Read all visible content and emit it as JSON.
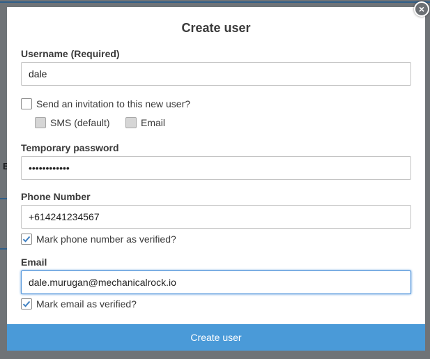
{
  "backdrop": {
    "fragment_left": "E"
  },
  "close_button": {
    "symbol": "×"
  },
  "dialog": {
    "title": "Create user",
    "username": {
      "label": "Username (Required)",
      "value": "dale"
    },
    "invite": {
      "label": "Send an invitation to this new user?",
      "checked": false,
      "options": [
        {
          "label": "SMS (default)",
          "checked": false,
          "disabled": true
        },
        {
          "label": "Email",
          "checked": false,
          "disabled": true
        }
      ]
    },
    "password": {
      "label": "Temporary password",
      "value": "••••••••••••"
    },
    "phone": {
      "label": "Phone Number",
      "value": "+614241234567"
    },
    "phone_verified": {
      "label": "Mark phone number as verified?",
      "checked": true
    },
    "email": {
      "label": "Email",
      "value": "dale.murugan@mechanicalrock.io"
    },
    "email_verified": {
      "label": "Mark email as verified?",
      "checked": true
    },
    "submit_label": "Create user"
  },
  "colors": {
    "accent": "#4a9ad8",
    "focus": "#4a90d9",
    "overlay": "#6f7377"
  }
}
